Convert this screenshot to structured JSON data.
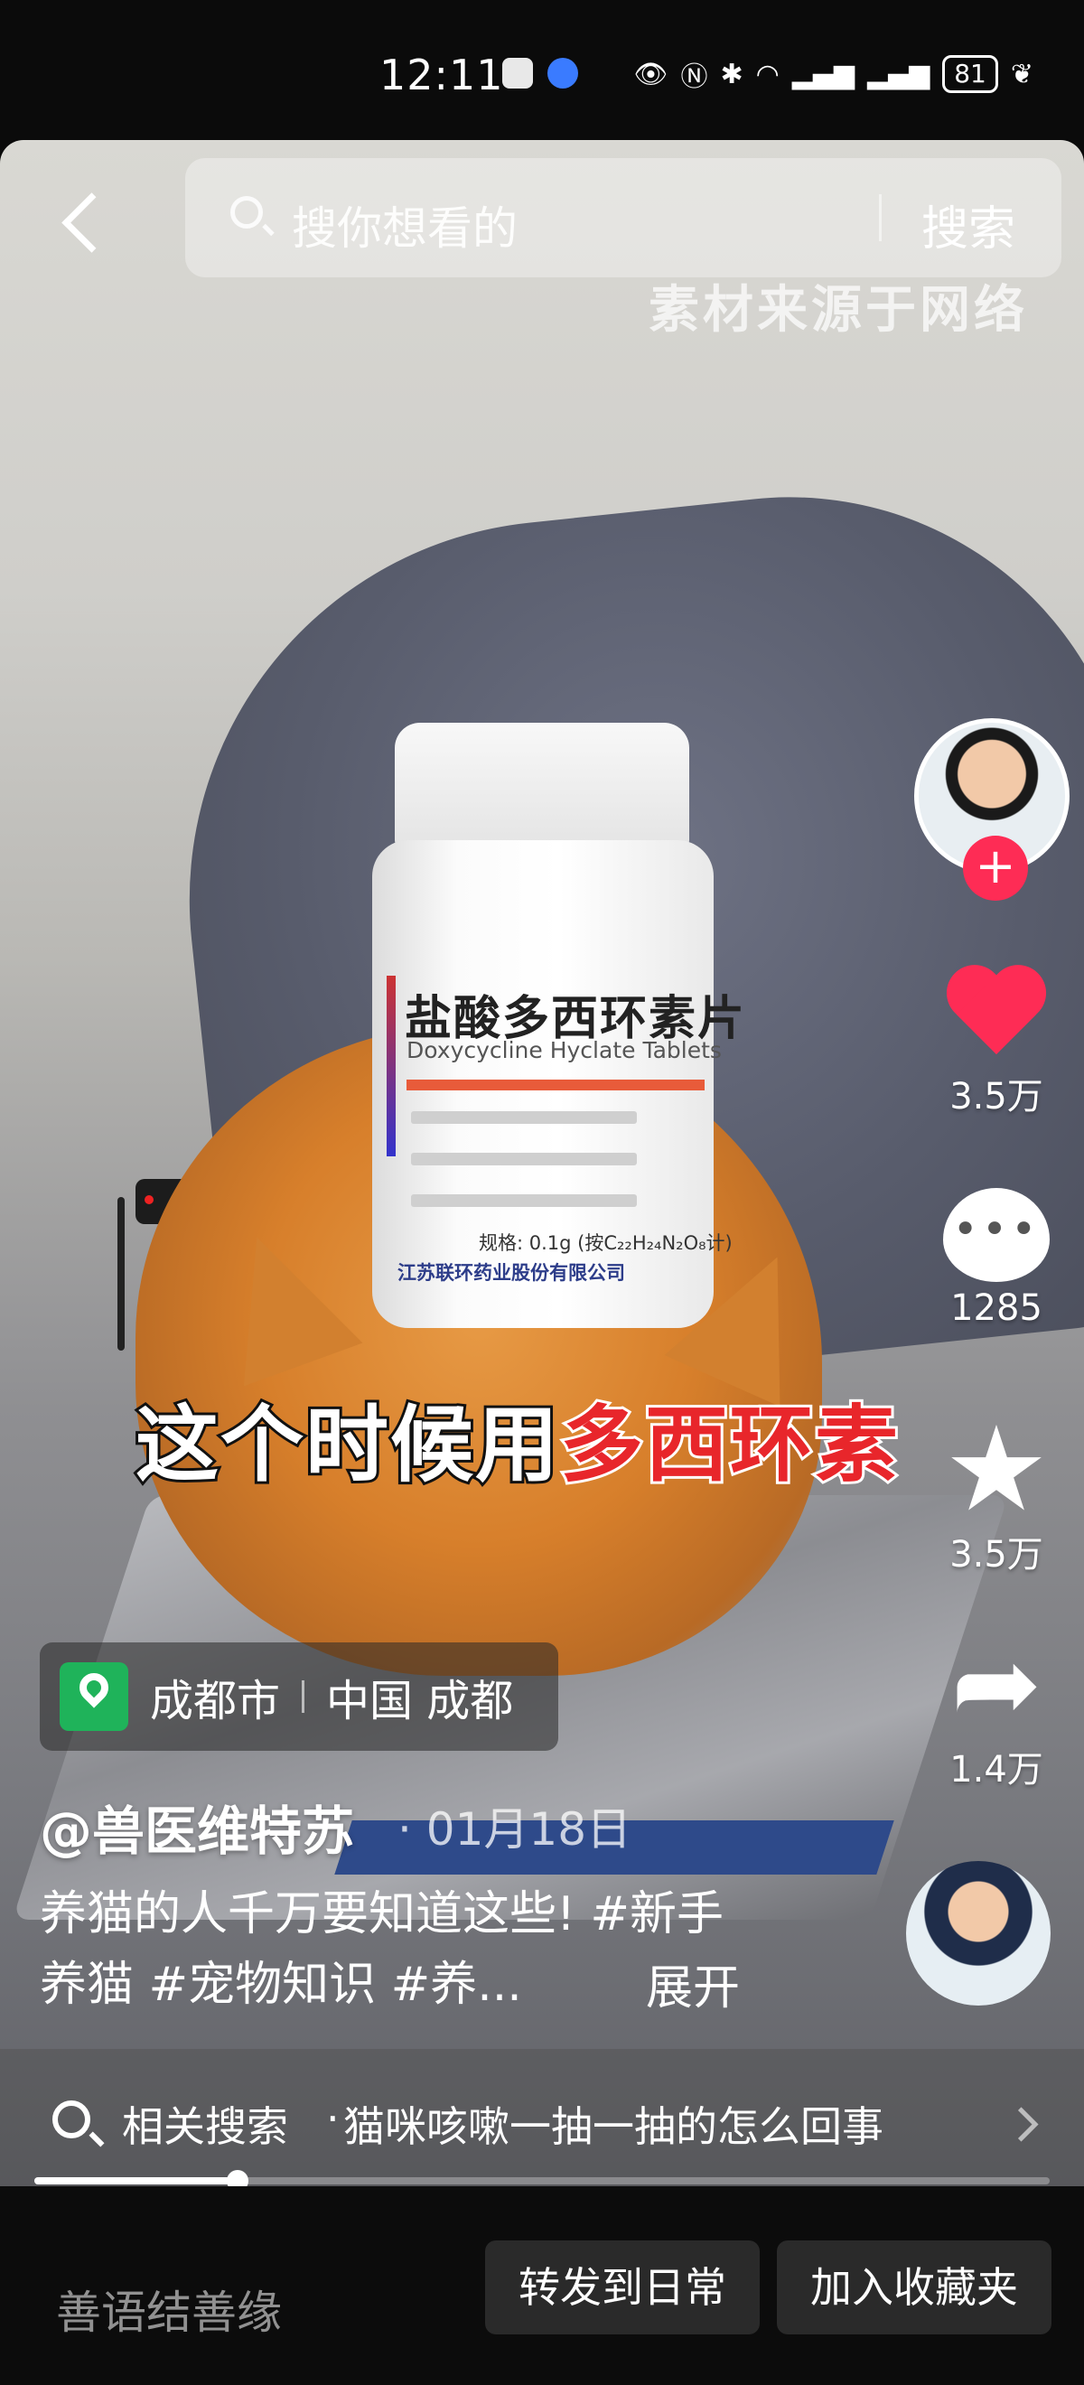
{
  "status_bar": {
    "time": "12:11",
    "battery": "81"
  },
  "search": {
    "placeholder": "搜你想看的",
    "button": "搜索"
  },
  "video": {
    "watermark": "素材来源于网络",
    "caption_white": "这个时候用",
    "caption_red": "多西环素",
    "bottle": {
      "name_cn": "盐酸多西环素片",
      "name_en": "Doxycycline Hyclate Tablets",
      "spec": "规格: 0.1g (按C₂₂H₂₄N₂O₈计)",
      "maker": "江苏联环药业股份有限公司"
    }
  },
  "actions": {
    "likes": "3.5万",
    "comments": "1285",
    "favorites": "3.5万",
    "shares": "1.4万"
  },
  "location": {
    "city": "成都市",
    "region": "中国 成都"
  },
  "author": "@兽医维特苏",
  "date": "· 01月18日",
  "description": "养猫的人千万要知道这些! #新手养猫 #宠物知识 #养...",
  "expand": "展开",
  "related": {
    "label": "相关搜索",
    "separator": "·",
    "query": "猫咪咳嗽一抽一抽的怎么回事"
  },
  "progress": {
    "fraction": 0.2
  },
  "bottom_bar": {
    "comment_placeholder": "善语结善缘",
    "repost": "转发到日常",
    "collect": "加入收藏夹"
  }
}
